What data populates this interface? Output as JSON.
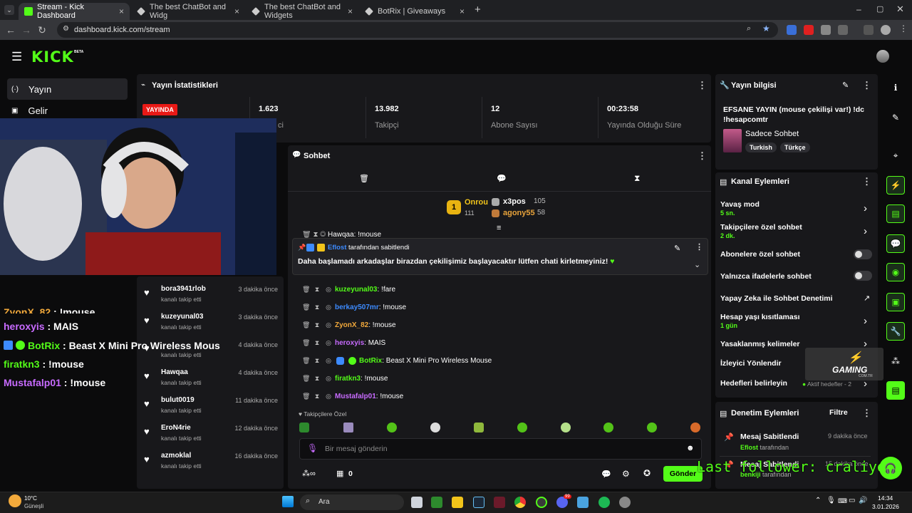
{
  "browser": {
    "tabs": [
      {
        "title": "Stream - Kick Dashboard",
        "active": true
      },
      {
        "title": "The best ChatBot and Widg"
      },
      {
        "title": "The best ChatBot and Widgets"
      },
      {
        "title": "BotRix | Giveaways"
      }
    ],
    "url": "dashboard.kick.com/stream"
  },
  "header": {
    "logo": "KICK",
    "beta": "BETA"
  },
  "nav": [
    {
      "icon": "broadcast-icon",
      "label": "Yayın"
    },
    {
      "icon": "revenue-icon",
      "label": "Gelir"
    }
  ],
  "stats": {
    "title": "Yayın İstatistikleri",
    "live_badge": "YAYINDA",
    "viewers_value": "1.623",
    "viewers_label_partial": "ci",
    "followers_value": "13.982",
    "followers_label": "Takipçi",
    "subs_value": "12",
    "subs_label": "Abone Sayısı",
    "uptime_value": "00:23:58",
    "uptime_label": "Yayında Olduğu Süre"
  },
  "overlay_chat": [
    {
      "user": "ZyonX_82",
      "text": " : !mouse",
      "color": "#f2a93b"
    },
    {
      "user": "heroxyis",
      "text": " : MAIS",
      "color": "#c86bff"
    },
    {
      "user": "BotRix",
      "text": " : Beast X Mini Pro Wireless Mous",
      "color": "#53fc18"
    },
    {
      "user": "firatkn3",
      "text": " : !mouse",
      "color": "#53fc18"
    },
    {
      "user": "Mustafalp01",
      "text": " : !mouse",
      "color": "#c86bff"
    }
  ],
  "followers": [
    {
      "name": "bora3941rlob",
      "sub": "kanalı takip etti",
      "time": "3 dakika önce"
    },
    {
      "name": "kuzeyunal03",
      "sub": "kanalı takip etti",
      "time": "3 dakika önce"
    },
    {
      "name": "",
      "sub": "kanalı takip etti",
      "time": "4 dakika önce"
    },
    {
      "name": "Hawqaa",
      "sub": "kanalı takip etti",
      "time": "4 dakika önce"
    },
    {
      "name": "bulut0019",
      "sub": "kanalı takip etti",
      "time": "11 dakika önce"
    },
    {
      "name": "EroN4rie",
      "sub": "kanalı takip etti",
      "time": "12 dakika önce"
    },
    {
      "name": "azmoklal",
      "sub": "kanalı takip etti",
      "time": "16 dakika önce"
    }
  ],
  "chat": {
    "title": "Sohbet",
    "leaderboard": [
      {
        "name": "Onrou",
        "amount": "111"
      },
      {
        "name": "x3pos",
        "amount": "105"
      },
      {
        "name": "agony55",
        "amount": "58"
      }
    ],
    "partial_line": "Hawqaa: !mouse",
    "pinned_by": "Eflost",
    "pinned_suffix": "tarafından sabitlendi",
    "pinned_text": "Daha başlamadı arkadaşlar birazdan çekilişimiz başlayacaktır lütfen chati kirletmeyiniz!",
    "messages": [
      {
        "user": "kuzeyunal03",
        "text": ": !fare",
        "color": "#53fc18"
      },
      {
        "user": "berkay507mr",
        "text": ": !mouse",
        "color": "#3d8bff"
      },
      {
        "user": "ZyonX_82",
        "text": ": !mouse",
        "color": "#f2a93b"
      },
      {
        "user": "heroxyis",
        "text": ": MAIS",
        "color": "#c86bff"
      },
      {
        "user": "BotRix",
        "text": ": Beast X Mini Pro Wireless Mouse",
        "color": "#53fc18"
      },
      {
        "user": "firatkn3",
        "text": ": !mouse",
        "color": "#53fc18"
      },
      {
        "user": "Mustafalp01",
        "text": ": !mouse",
        "color": "#c86bff"
      }
    ],
    "emote_section": "Takipçilere Özel",
    "input_placeholder": "Bir mesaj gönderin",
    "points": "0",
    "send_label": "Gönder"
  },
  "info": {
    "title": "Yayın bilgisi",
    "stream_title": "EFSANE YAYIN (mouse çekilişi var!) !dc !hesapcomtr",
    "category": "Sadece Sohbet",
    "tags": [
      "Turkish",
      "Türkçe"
    ]
  },
  "channel": {
    "title": "Kanal Eylemleri",
    "slow_mode": "Yavaş mod",
    "slow_mode_value": "5 sn.",
    "followers_only": "Takipçilere özel sohbet",
    "followers_only_value": "2 dk.",
    "subs_only": "Abonelere özel sohbet",
    "emotes_only": "Yalnızca ifadelerle sohbet",
    "ai_moderation": "Yapay Zeka ile Sohbet Denetimi",
    "age_restriction": "Hesap yaşı kısıtlaması",
    "age_restriction_value": "1 gün",
    "banned_words": "Yasaklanmış kelimeler",
    "viewer_redirect": "İzleyici Yönlendir",
    "goals": "Hedefleri belirleyin",
    "goals_value": "Aktif hedefler - 2"
  },
  "moderation": {
    "title": "Denetim Eylemleri",
    "filter": "Filtre",
    "items": [
      {
        "action": "Mesaj Sabitlendi",
        "time": "9 dakika önce",
        "by": "Eflost",
        "suffix": "tarafından"
      },
      {
        "action": "Mesaj Sabitlendi",
        "time": "15 dakika önce",
        "by": "benkiji",
        "suffix": "tarafından"
      }
    ]
  },
  "watermark": {
    "brand": "GAMING",
    "sub": "COM.TR"
  },
  "overlay_last_follower": "Last follower: craliyet",
  "taskbar": {
    "weather_temp": "10°C",
    "weather_desc": "Güneşli",
    "search": "Ara",
    "time": "14:34",
    "date": "3.01.2026",
    "badge": "99"
  },
  "colors": {
    "accent": "#53fc18",
    "live": "#e91916",
    "panel": "#18181b"
  }
}
